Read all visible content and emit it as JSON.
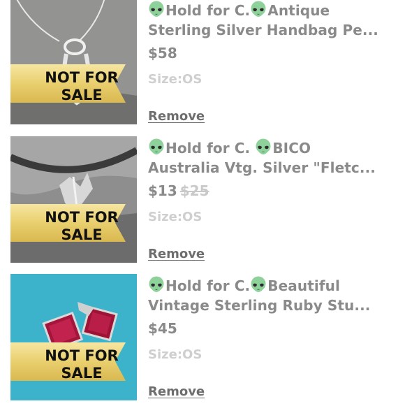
{
  "items": [
    {
      "title_line1": "Hold for C.",
      "title_line1b": "Antique",
      "title_line2": "Sterling Silver Handbag Pe...",
      "price": "$58",
      "original_price": "",
      "size": "Size:OS",
      "remove_label": "Remove",
      "overlay_line1": "NOT FOR",
      "overlay_line2": "SALE"
    },
    {
      "title_line1": "Hold for C. ",
      "title_line1b": "BICO",
      "title_line2": "Australia Vtg. Silver \"Fletc...",
      "price": "$13",
      "original_price": "$25",
      "size": "Size:OS",
      "remove_label": "Remove",
      "overlay_line1": "NOT FOR",
      "overlay_line2": "SALE"
    },
    {
      "title_line1": "Hold for C.",
      "title_line1b": "Beautiful",
      "title_line2": "Vintage Sterling Ruby Stu...",
      "price": "$45",
      "original_price": "",
      "size": "Size:OS",
      "remove_label": "Remove",
      "overlay_line1": "NOT FOR",
      "overlay_line2": "SALE"
    }
  ],
  "icons": {
    "title_emoji": "alien-icon"
  },
  "colors": {
    "title": "#8a8a8a",
    "price": "#8a8a8a",
    "strike_price": "#c9c9c9",
    "size": "#cfcfcf",
    "remove_link": "#6e6e6e",
    "banner_gold": "#e8d27a",
    "thumb3_bg": "#3fb6cf"
  }
}
